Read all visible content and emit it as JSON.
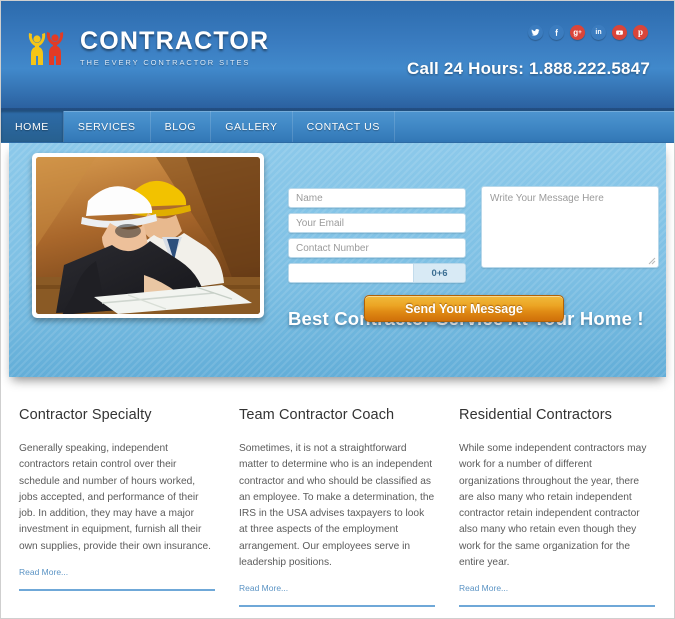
{
  "header": {
    "logo": {
      "title": "CONTRACTOR",
      "subtitle": "THE EVERY CONTRACTOR  SITES",
      "icon_left": "person-yellow-icon",
      "icon_right": "person-red-icon",
      "color_yellow": "#f5c517",
      "color_red": "#e23b25"
    },
    "phone": "Call 24 Hours: 1.888.222.5847",
    "social": [
      {
        "name": "twitter-icon",
        "label": "Twitter",
        "glyph": "t",
        "color": "#3b7cbf"
      },
      {
        "name": "facebook-icon",
        "label": "Facebook",
        "glyph": "f",
        "color": "#3b7cbf"
      },
      {
        "name": "googleplus-icon",
        "label": "Google Plus",
        "glyph": "g+",
        "color": "#d9453a"
      },
      {
        "name": "linkedin-icon",
        "label": "LinkedIn",
        "glyph": "in",
        "color": "#3b7cbf"
      },
      {
        "name": "youtube-icon",
        "label": "YouTube",
        "glyph": "▶",
        "color": "#d9453a"
      },
      {
        "name": "pinterest-icon",
        "label": "Pinterest",
        "glyph": "p",
        "color": "#d9453a"
      }
    ],
    "bg_color": "#3a7cc0"
  },
  "nav": {
    "items": [
      {
        "label": "HOME",
        "active": true
      },
      {
        "label": "SERVICES",
        "active": false
      },
      {
        "label": "BLOG",
        "active": false
      },
      {
        "label": "GALLERY",
        "active": false
      },
      {
        "label": "CONTACT US",
        "active": false
      }
    ],
    "bg_color": "#4189c6",
    "active_bg_color": "#2d6ba8"
  },
  "hero": {
    "title": "Best Contractor Service At Your Home !",
    "bg_color": "#7ec0e4",
    "photo": {
      "name": "contractors-reviewing-blueprints-photo",
      "alt": "Two contractors in white and yellow hard hats reviewing blueprints in a wooden attic"
    },
    "form": {
      "name_placeholder": "Name",
      "email_placeholder": "Your Email",
      "contact_placeholder": "Contact Number",
      "captcha_value": "",
      "captcha_code": "0+6",
      "message_placeholder": "Write Your Message Here",
      "submit_label": "Send Your Message",
      "submit_color": "#e08b14"
    }
  },
  "columns": [
    {
      "title": "Contractor Specialty",
      "body": "Generally speaking, independent contractors retain control over their schedule and number of hours worked, jobs accepted, and performance of their job. In addition, they may have a major investment in equipment, furnish all their own supplies, provide their own insurance.",
      "read_more": "Read More..."
    },
    {
      "title": "Team Contractor Coach",
      "body": "Sometimes, it is not a straightforward matter to determine who is an independent contractor and who should be classified as an employee. To make a determination, the IRS in the USA advises taxpayers to look at three aspects of the employment arrangement. Our employees serve in leadership positions.",
      "read_more": "Read More..."
    },
    {
      "title": "Residential Contractors",
      "body": "While some independent contractors may work for a number of different organizations throughout the year, there are also many who retain independent contractor retain independent contractor also many who retain even though they work for the same organization for the entire year.",
      "read_more": "Read More..."
    }
  ],
  "accent_color": "#6fa8d8"
}
